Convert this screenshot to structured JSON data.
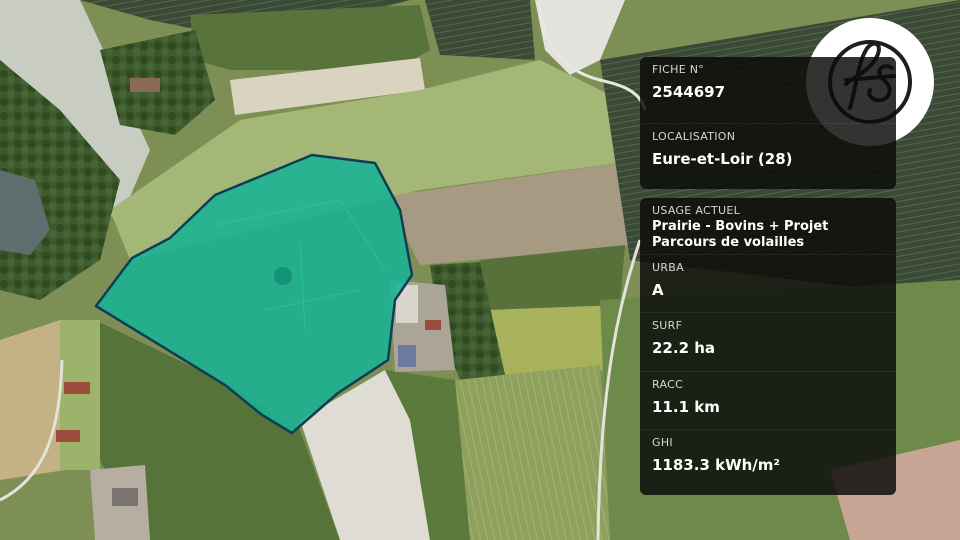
{
  "map": {
    "parcel_fill": "#19b394",
    "parcel_stroke": "#0f3e54",
    "landscape": "aerial-farmland"
  },
  "logo": {
    "text": "fs",
    "icon": "fs-monogram-logo"
  },
  "info_card_primary": {
    "fiche": {
      "label": "FICHE N°",
      "value": "2544697"
    },
    "localisation": {
      "label": "LOCALISATION",
      "value": "Eure-et-Loir (28)"
    }
  },
  "info_card_details": {
    "usage": {
      "label": "USAGE ACTUEL",
      "value": "Prairie - Bovins + Projet Parcours de volailles"
    },
    "urba": {
      "label": "URBA",
      "value": "A"
    },
    "surf": {
      "label": "SURF",
      "value": "22.2 ha"
    },
    "racc": {
      "label": "RACC",
      "value": "11.1 km"
    },
    "ghi": {
      "label": "GHI",
      "value": "1183.3 kWh/m²"
    }
  }
}
